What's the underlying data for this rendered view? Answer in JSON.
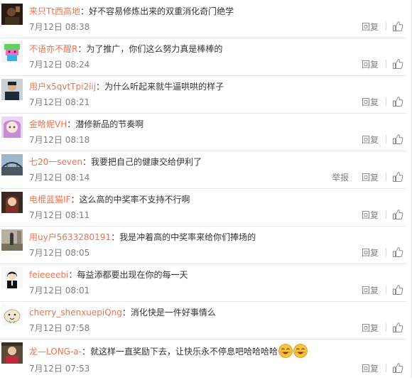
{
  "comments": [
    {
      "user": "来只Tt西高地",
      "content": "好不容易修炼出来的双重消化奇门绝学",
      "time": "7月12日 08:38",
      "reply": "回复",
      "avatar": "avatar-dark-photo"
    },
    {
      "user": "不语亦不醒R",
      "content": "为了推广，你们这么努力真是棒棒的",
      "time": "7月12日 08:24",
      "reply": "回复",
      "avatar": "avatar-cartoon-green"
    },
    {
      "user": "用户x5qvtTpi2iij",
      "content": "为什么听起来就牛逼哄哄的样子",
      "time": "7月12日 08:21",
      "reply": "回复",
      "avatar": "avatar-person-photo"
    },
    {
      "user": "金哈妮VH",
      "content": "潜修新品的节奏啊",
      "time": "7月12日 08:18",
      "reply": "回复",
      "avatar": "avatar-anime-girl"
    },
    {
      "user": "七20一seven",
      "content": "我要把自己的健康交给伊利了",
      "time": "7月12日 08:14",
      "report": "举报",
      "reply": "回复",
      "avatar": "avatar-bridge-photo"
    },
    {
      "user": "电棍蓝猫IF",
      "content": "这么高的中奖率不支持不行啊",
      "time": "7月12日 08:11",
      "reply": "回复",
      "avatar": "avatar-girl-photo"
    },
    {
      "user": "用uy户5633280191",
      "content": "我是冲着高的中奖率来给你们捧场的",
      "time": "7月12日 08:05",
      "reply": "回复",
      "avatar": "avatar-street-photo"
    },
    {
      "user": "feieeeebi",
      "content": "每益添都要出现在你的每一天",
      "time": "7月12日 08:01",
      "reply": "回复",
      "avatar": "avatar-boy-sketch"
    },
    {
      "user": "cherry_shenxuepiQng",
      "content": "消化快是一件好事情么",
      "time": "7月12日 07:58",
      "reply": "回复",
      "avatar": "avatar-cartoon-face"
    },
    {
      "user": "龙—LONG-a-",
      "content": "就这样一直奖励下去，让快乐永不停息吧哈哈哈哈",
      "time": "7月12日 07:53",
      "reply": "回复",
      "avatar": "avatar-red-photo",
      "emoji": "laughing-emoji"
    }
  ],
  "colors": {
    "username": "#eb7350",
    "meta": "#808080",
    "divider": "#e9e9e9"
  }
}
